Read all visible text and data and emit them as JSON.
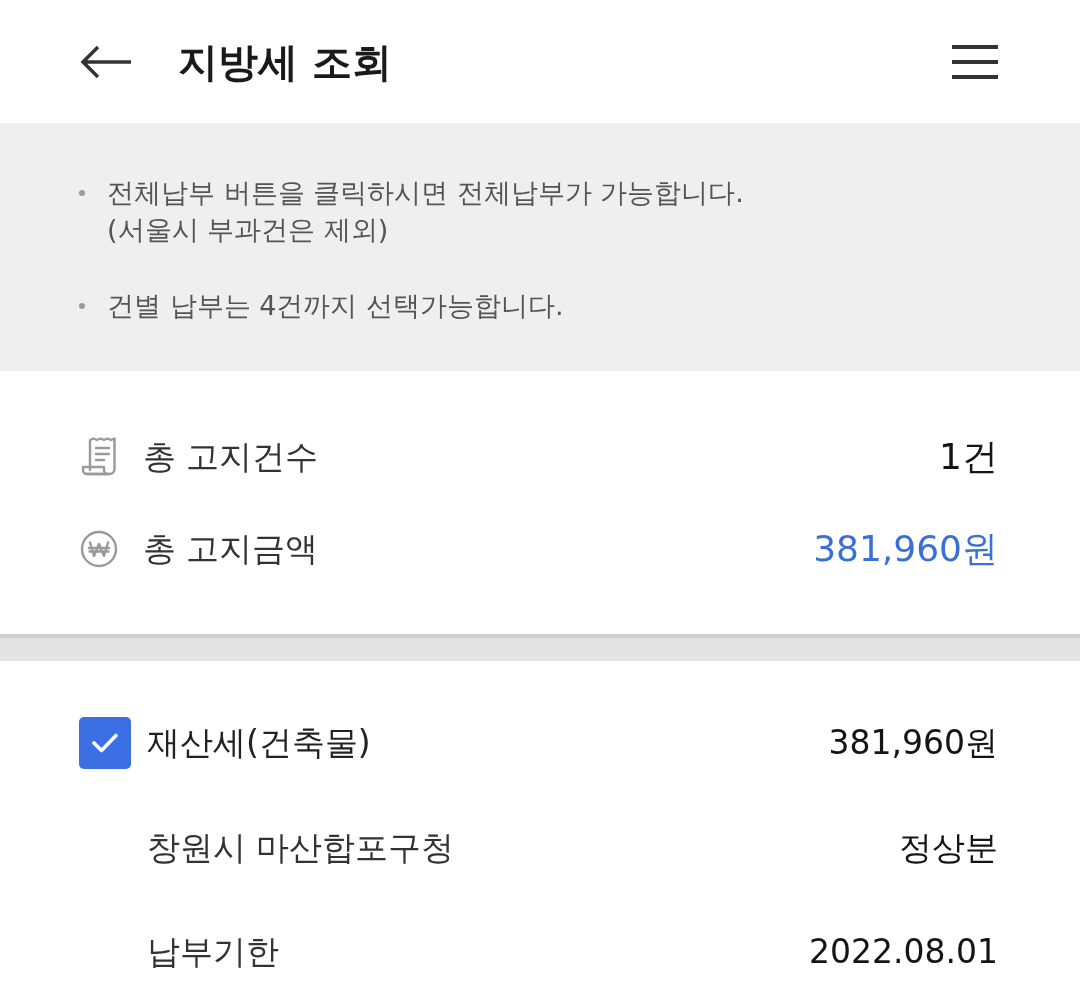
{
  "header": {
    "title": "지방세 조회"
  },
  "notices": [
    {
      "text": "전체납부 버튼을 클릭하시면 전체납부가 가능합니다.\n(서울시 부과건은 제외)"
    },
    {
      "text": "건별 납부는 4건까지 선택가능합니다."
    }
  ],
  "summary": [
    {
      "kind": "receipt",
      "label": "총 고지건수",
      "value": "1건",
      "highlight": false
    },
    {
      "kind": "won",
      "label": "총 고지금액",
      "value": "381,960원",
      "highlight": true
    }
  ],
  "bills": [
    {
      "name": "재산세(건축물)",
      "checked": true,
      "amount": "381,960원",
      "office": "창원시 마산합포구청",
      "category": "정상분",
      "due_label": "납부기한",
      "due_date": "2022.08.01"
    }
  ]
}
